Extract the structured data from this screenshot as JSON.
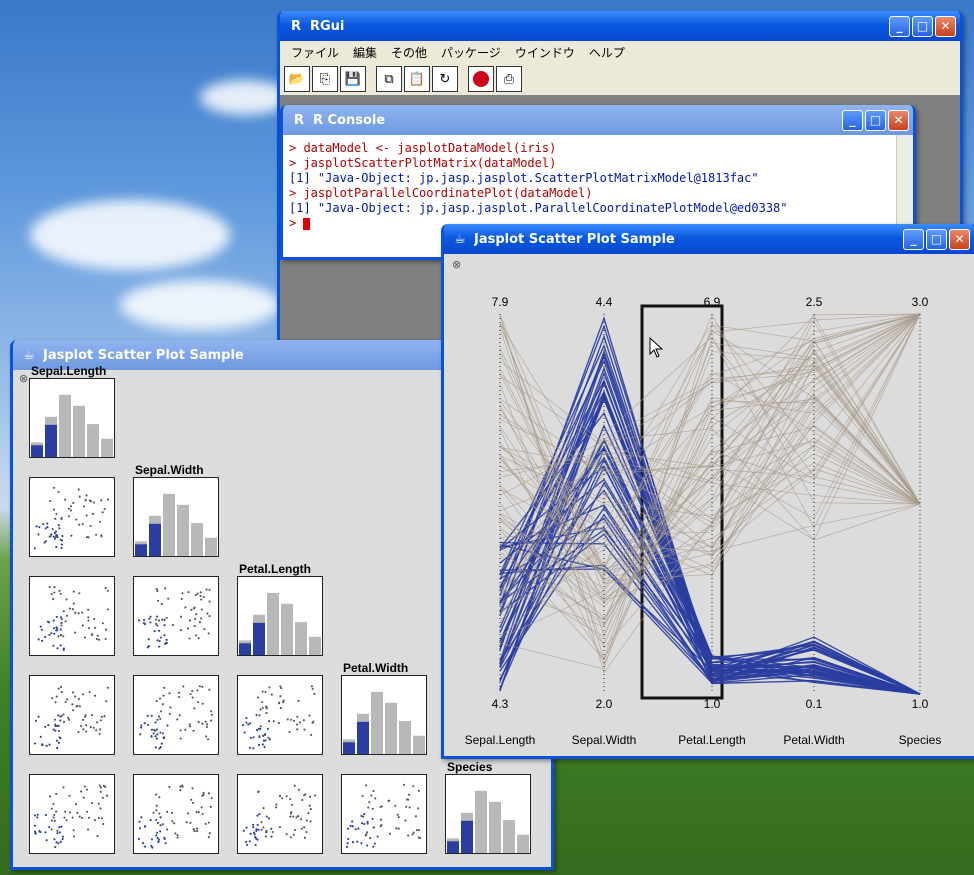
{
  "rgui": {
    "title": "RGui",
    "menu": [
      "ファイル",
      "編集",
      "その他",
      "パッケージ",
      "ウインドウ",
      "ヘルプ"
    ],
    "toolbar_icons": [
      "open-icon",
      "load-workspace-icon",
      "save-icon",
      "copy-icon",
      "paste-icon",
      "refresh-icon",
      "stop-icon",
      "print-icon"
    ]
  },
  "console": {
    "title": "R Console",
    "lines": [
      {
        "type": "cmd",
        "text": "> dataModel <- jasplotDataModel(iris)"
      },
      {
        "type": "cmd",
        "text": "> jasplotScatterPlotMatrix(dataModel)"
      },
      {
        "type": "out",
        "text": "[1] \"Java-Object: jp.jasp.jasplot.ScatterPlotMatrixModel@1813fac\""
      },
      {
        "type": "cmd",
        "text": "> jasplotParallelCoordinatePlot(dataModel)"
      },
      {
        "type": "out",
        "text": "[1] \"Java-Object: jp.jasp.jasplot.ParallelCoordinatePlotModel@ed0338\""
      }
    ],
    "prompt": ">"
  },
  "matrix_window": {
    "title": "Jasplot Scatter Plot Sample",
    "variables": [
      "Sepal.Length",
      "Sepal.Width",
      "Petal.Length",
      "Petal.Width",
      "Species"
    ]
  },
  "parallel_window": {
    "title": "Jasplot Scatter Plot Sample",
    "axes": [
      {
        "name": "Sepal.Length",
        "max": "7.9",
        "min": "4.3"
      },
      {
        "name": "Sepal.Width",
        "max": "4.4",
        "min": "2.0"
      },
      {
        "name": "Petal.Length",
        "max": "6.9",
        "min": "1.0"
      },
      {
        "name": "Petal.Width",
        "max": "2.5",
        "min": "0.1"
      },
      {
        "name": "Species",
        "max": "3.0",
        "min": "1.0"
      }
    ]
  },
  "colors": {
    "selected": "#2a3da0",
    "unselected": "#a89a8a",
    "histogram_gray": "#b8b8b8"
  }
}
